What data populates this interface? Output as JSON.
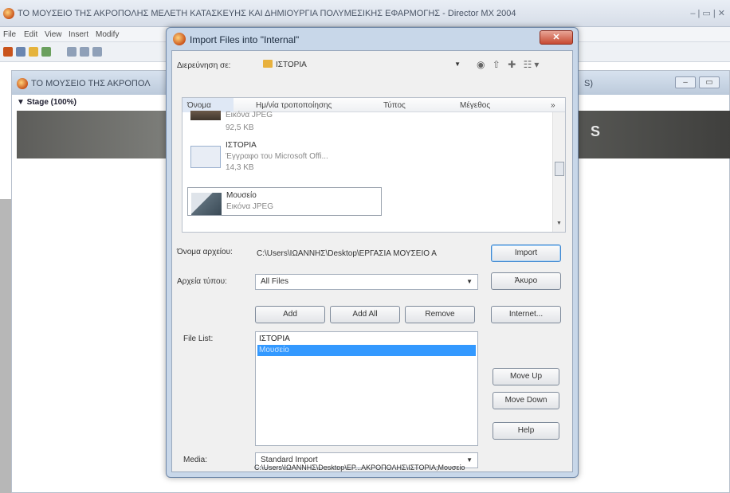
{
  "app": {
    "title": "ΤΟ ΜΟΥΣΕΙΟ ΤΗΣ ΑΚΡΟΠΟΛΗΣ ΜΕΛΕΤΗ ΚΑΤΑΣΚΕΥΗΣ ΚΑΙ ΔΗΜΙΟΥΡΓΙΑ ΠΟΛΥΜΕΣΙΚΗΣ ΕΦΑΡΜΟΓΗΣ - Director MX 2004",
    "window_controls": "– | ▭ | ✕",
    "menu": [
      "File",
      "Edit",
      "View",
      "Insert",
      "Modify"
    ]
  },
  "stage": {
    "title": "ΤΟ ΜΟΥΣΕΙΟ ΤΗΣ ΑΚΡΟΠΟΛ",
    "suffix": "S)",
    "label": "▼ Stage (100%)",
    "canvas_letter": "S"
  },
  "dialog": {
    "title": "Import Files into \"Internal\"",
    "close_label": "✕",
    "look_in_label": "Διερεύνηση σε:",
    "look_in_value": "ΙΣΤΟΡΙΑ",
    "columns": [
      "Όνομα",
      "Ημ/νία τροποποίησης",
      "Τύπος",
      "Μέγεθος"
    ],
    "files": [
      {
        "name": "",
        "type": "Εικόνα JPEG",
        "size": "92,5 KB"
      },
      {
        "name": "ΙΣΤΟΡΙΑ",
        "type": "Έγγραφο του Microsoft Offi...",
        "size": "14,3 KB"
      },
      {
        "name": "Μουσείο",
        "type": "Εικόνα JPEG",
        "size": ""
      }
    ],
    "filename_label": "Όνομα αρχείου:",
    "filename_value": "C:\\Users\\ΙΩΑΝΝΗΣ\\Desktop\\ΕΡΓΑΣΙΑ ΜΟΥΣΕΙΟ Α",
    "filetype_label": "Αρχεία τύπου:",
    "filetype_value": "All Files",
    "buttons": {
      "import": "Import",
      "cancel": "Άκυρο",
      "internet": "Internet...",
      "add": "Add",
      "add_all": "Add All",
      "remove": "Remove",
      "move_up": "Move Up",
      "move_down": "Move Down",
      "help": "Help"
    },
    "file_list_label": "File List:",
    "file_list": [
      "ΙΣΤΟΡΙΑ",
      "Μουσείο"
    ],
    "media_label": "Media:",
    "media_value": "Standard Import",
    "path_text": "C:\\Users\\ΙΩΑΝΝΗΣ\\Desktop\\ΕΡ...ΑΚΡΟΠΟΛΗΣ\\ΙΣΤΟΡΙΑ;Μουσείο"
  }
}
